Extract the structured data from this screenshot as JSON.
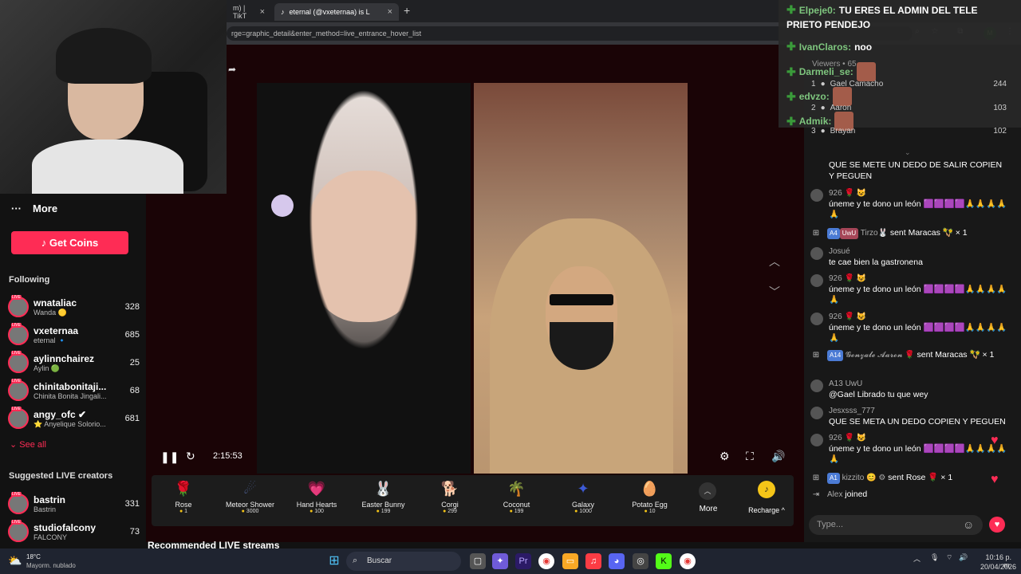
{
  "browser": {
    "tabs": [
      {
        "label": "m) | TikT"
      },
      {
        "label": "eternal (@vxeternaa) is L"
      }
    ],
    "new_tab": "+",
    "url": "rge=graphic_detail&enter_method=live_entrance_hover_list",
    "profile_initial": "M"
  },
  "sidebar": {
    "more_label": "More",
    "get_coins": "Get Coins",
    "following_label": "Following",
    "following": [
      {
        "name": "wnataliac",
        "sub": "Wanda 🟡",
        "count": "328"
      },
      {
        "name": "vxeternaa",
        "sub": "eternal 🔹",
        "count": "685"
      },
      {
        "name": "aylinnchairez",
        "sub": "Aylin 🟢",
        "count": "25"
      },
      {
        "name": "chinitabonitaji...",
        "sub": "Chinita Bonita Jingali...",
        "count": "68"
      },
      {
        "name": "angy_ofc ✔",
        "sub": "⭐ Anyelique Solorio...",
        "count": "681"
      }
    ],
    "see_all": "See all",
    "suggested_label": "Suggested LIVE creators",
    "suggested": [
      {
        "name": "bastrin",
        "sub": "Bastrin",
        "count": "331"
      },
      {
        "name": "studiofalcony",
        "sub": "FALCONY",
        "count": "73"
      }
    ]
  },
  "player": {
    "time": "2:15:53"
  },
  "gifts": [
    {
      "name": "Rose",
      "price": "1",
      "icon": "🌹",
      "color": "#d8293e"
    },
    {
      "name": "Meteor Shower",
      "price": "3000",
      "icon": "☄",
      "color": "#4a5b8a"
    },
    {
      "name": "Hand Hearts",
      "price": "100",
      "icon": "💗",
      "color": "#d657a3"
    },
    {
      "name": "Easter Bunny",
      "price": "199",
      "icon": "🐰",
      "color": "#7a8fd0"
    },
    {
      "name": "Corgi",
      "price": "299",
      "icon": "🐕",
      "color": "#e5a060"
    },
    {
      "name": "Coconut",
      "price": "199",
      "icon": "🌴",
      "color": "#3f9c4c"
    },
    {
      "name": "Galaxy",
      "price": "1000",
      "icon": "✦",
      "color": "#3d5ad6"
    },
    {
      "name": "Potato Egg",
      "price": "10",
      "icon": "🥚",
      "color": "#d9a777"
    }
  ],
  "gift_more": "More",
  "recharge": "Recharge ^",
  "recommended": "Recommended LIVE streams",
  "overlay": {
    "lines": [
      {
        "name": "Elpeje0:",
        "msg": "TU ERES EL ADMIN DEL TELE"
      },
      {
        "name": "",
        "msg": "PRIETO PENDEJO"
      },
      {
        "name": "IvanClaros:",
        "msg": "noo"
      },
      {
        "name": "Darmeli_se:",
        "msg": ""
      },
      {
        "name": "edvzo:",
        "msg": ""
      },
      {
        "name": "Admik:",
        "msg": ""
      }
    ],
    "viewers_label": "Viewers • 65"
  },
  "rankings": [
    {
      "rank": "1",
      "name": "Gael Camacho",
      "pts": "244"
    },
    {
      "rank": "2",
      "name": "Aaron",
      "pts": "103"
    },
    {
      "rank": "3",
      "name": "Brayan",
      "pts": "102"
    }
  ],
  "chat": [
    {
      "user": "",
      "text": "QUE SE METE UN DEDO DE SALIR COPIEN Y PEGUEN"
    },
    {
      "user": "926 🌹 😺",
      "text": "úneme y te dono un león 🟪🟪🟪🟪🙏🙏🙏🙏🙏"
    },
    {
      "user": "",
      "text": "sent Maracas 🪇 × 1",
      "sys": true,
      "badges": [
        "A4",
        "UwU"
      ],
      "name": "Tirzo🐰"
    },
    {
      "user": "Josué",
      "text": "te cae bien la gastronena"
    },
    {
      "user": "926 🌹 😺",
      "text": "úneme y te dono un león 🟪🟪🟪🟪🙏🙏🙏🙏🙏"
    },
    {
      "user": "926 🌹 😺",
      "text": "úneme y te dono un león 🟪🟪🟪🟪🙏🙏🙏🙏🙏"
    },
    {
      "user": "",
      "text": "sent Maracas 🪇 × 1",
      "sys": true,
      "badges": [
        "A14"
      ],
      "name": "𝓖𝓸𝓷𝔃𝓪𝓵𝓮 𝓐𝓪𝓻𝓸𝓷 🌹"
    },
    {
      "user": "A13 UwU",
      "text": "@Gael Librado tu que wey"
    },
    {
      "user": "Jesxsss_777",
      "text": "QUE SE META UN DEDO COPIEN Y PEGUEN"
    },
    {
      "user": "926 🌹 😺",
      "text": "úneme y te dono un león 🟪🟪🟪🟪🙏🙏🙏🙏🙏"
    },
    {
      "user": "",
      "text": "sent Rose 🌹 × 1",
      "sys": true,
      "badges": [
        "A1"
      ],
      "name": "kizzito 😊 ⚙"
    },
    {
      "user": "",
      "text": "joined",
      "sys": true,
      "badges": [],
      "name": "Alex"
    }
  ],
  "chat_input_placeholder": "Type...",
  "taskbar": {
    "weather_temp": "18°C",
    "weather_desc": "Mayorm. nublado",
    "search": "Buscar",
    "time": "10:16 p. m.",
    "date": "20/04/2026"
  }
}
